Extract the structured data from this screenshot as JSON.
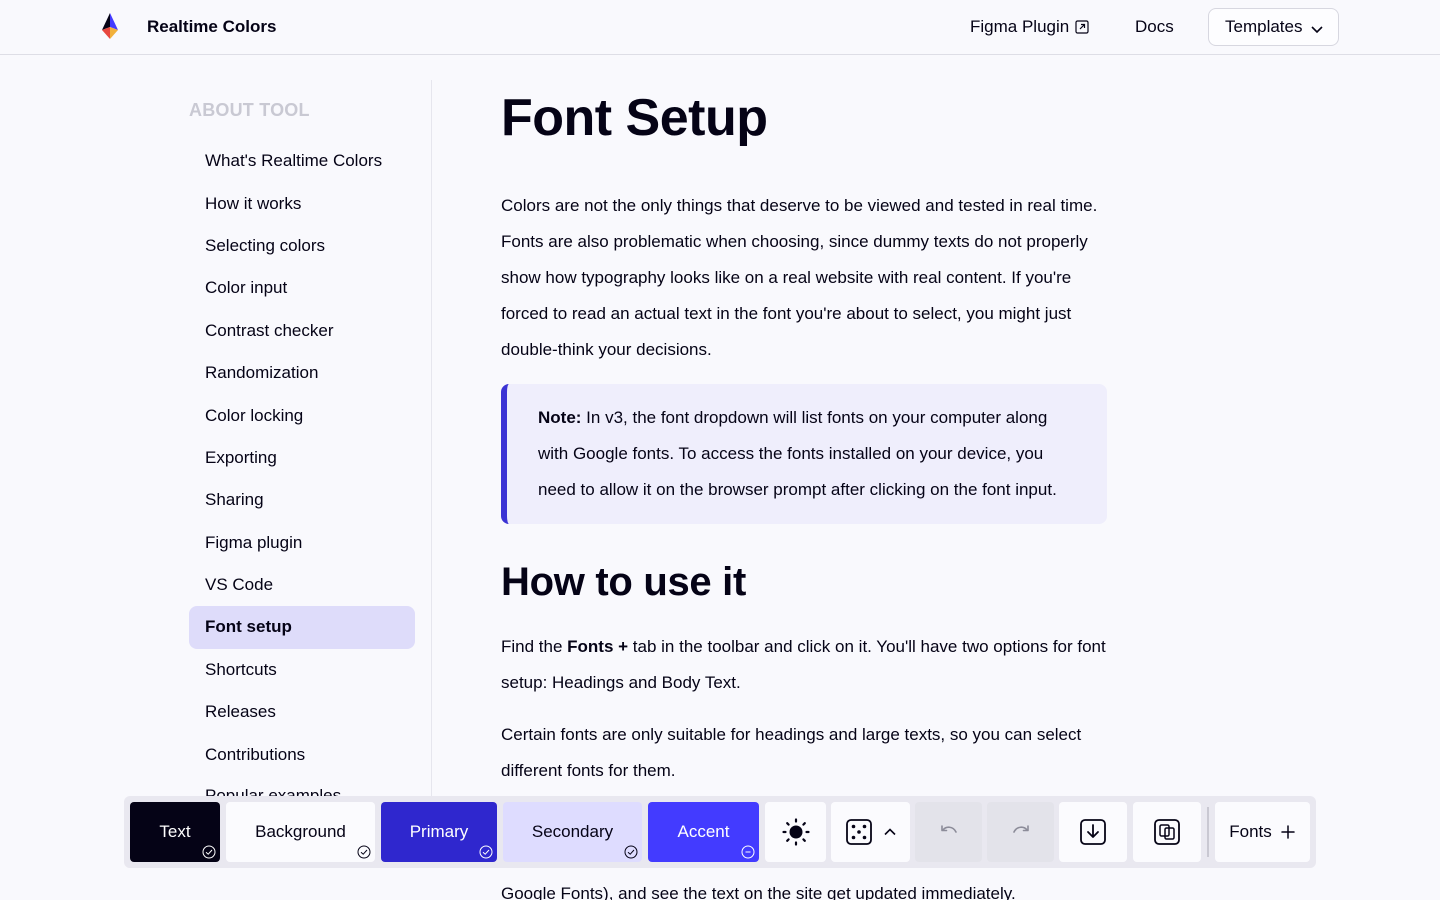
{
  "header": {
    "brand": "Realtime Colors",
    "nav_figma": "Figma Plugin",
    "nav_docs": "Docs",
    "templates": "Templates"
  },
  "sidebar": {
    "heading": "ABOUT TOOL",
    "items": [
      {
        "label": "What's Realtime Colors"
      },
      {
        "label": "How it works"
      },
      {
        "label": "Selecting colors"
      },
      {
        "label": "Color input"
      },
      {
        "label": "Contrast checker"
      },
      {
        "label": "Randomization"
      },
      {
        "label": "Color locking"
      },
      {
        "label": "Exporting"
      },
      {
        "label": "Sharing"
      },
      {
        "label": "Figma plugin"
      },
      {
        "label": "VS Code"
      },
      {
        "label": "Font setup",
        "active": true
      },
      {
        "label": "Shortcuts"
      },
      {
        "label": "Releases"
      },
      {
        "label": "Contributions"
      },
      {
        "label": "Popular examples"
      }
    ]
  },
  "main": {
    "title": "Font Setup",
    "intro": "Colors are not the only things that deserve to be viewed and tested in real time. Fonts are also problematic when choosing, since dummy texts do not properly show how typography looks like on a real website with real content. If you're forced to read an actual text in the font you're about to select, you might just double-think your decisions.",
    "note_label": "Note:",
    "note_text": " In v3, the font dropdown will list fonts on your computer along with Google fonts. To access the fonts installed on your device, you need to allow it on the browser prompt after clicking on the font input.",
    "section_title": "How to use it",
    "p2_before": "Find the ",
    "p2_bold": "Fonts +",
    "p2_after": " tab in the toolbar and click on it. You'll have two options for font setup: Headings and Body Text.",
    "p3": "Certain fonts are only suitable for headings and large texts, so you can select different fonts for them.",
    "p4": "Google Fonts), and see the text on the site get updated immediately."
  },
  "toolbar": {
    "text": "Text",
    "background": "Background",
    "primary": "Primary",
    "secondary": "Secondary",
    "accent": "Accent",
    "fonts": "Fonts"
  },
  "colors": {
    "text": "#050316",
    "background": "#fbfbfe",
    "primary": "#2f27ce",
    "secondary": "#dedcff",
    "accent": "#433bff"
  }
}
